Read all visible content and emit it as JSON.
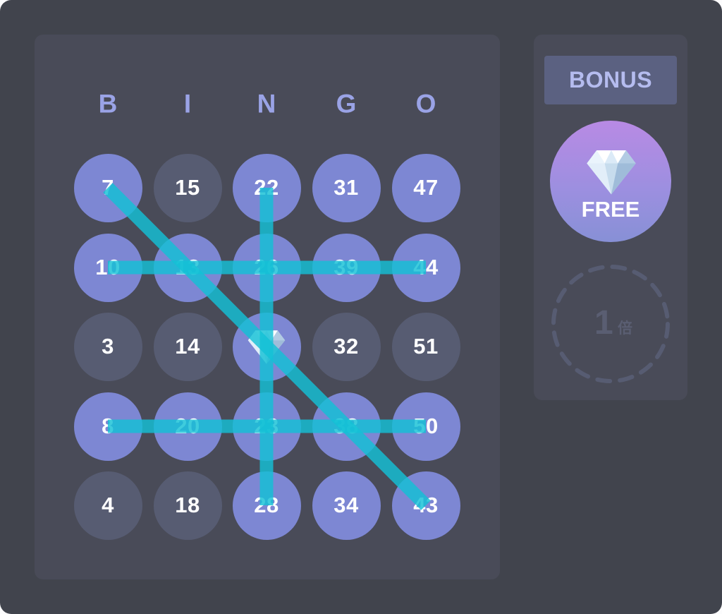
{
  "headers": [
    "B",
    "I",
    "N",
    "G",
    "O"
  ],
  "grid": [
    [
      {
        "label": "7",
        "marked": true
      },
      {
        "label": "15",
        "marked": false
      },
      {
        "label": "22",
        "marked": true
      },
      {
        "label": "31",
        "marked": true
      },
      {
        "label": "47",
        "marked": true
      }
    ],
    [
      {
        "label": "10",
        "marked": true
      },
      {
        "label": "13",
        "marked": true
      },
      {
        "label": "26",
        "marked": true
      },
      {
        "label": "39",
        "marked": true
      },
      {
        "label": "44",
        "marked": true
      }
    ],
    [
      {
        "label": "3",
        "marked": false
      },
      {
        "label": "14",
        "marked": false
      },
      {
        "label": "",
        "marked": true,
        "free": true,
        "icon": "diamond-icon"
      },
      {
        "label": "32",
        "marked": false
      },
      {
        "label": "51",
        "marked": false
      }
    ],
    [
      {
        "label": "8",
        "marked": true
      },
      {
        "label": "20",
        "marked": true
      },
      {
        "label": "23",
        "marked": true
      },
      {
        "label": "38",
        "marked": true
      },
      {
        "label": "50",
        "marked": true
      }
    ],
    [
      {
        "label": "4",
        "marked": false
      },
      {
        "label": "18",
        "marked": false
      },
      {
        "label": "28",
        "marked": true
      },
      {
        "label": "34",
        "marked": true
      },
      {
        "label": "43",
        "marked": true
      }
    ]
  ],
  "bingo_lines": [
    {
      "type": "row",
      "index": 1
    },
    {
      "type": "row",
      "index": 3
    },
    {
      "type": "column",
      "index": 2
    },
    {
      "type": "diagonal",
      "direction": "main"
    }
  ],
  "sidebar": {
    "bonus_label": "BONUS",
    "free_label": "FREE",
    "free_icon": "diamond-icon",
    "multiplier_value": "1",
    "multiplier_unit": "倍"
  },
  "colors": {
    "background": "#41444d",
    "panel": "#494b58",
    "marked_cell": "#7d87d3",
    "unmarked_cell": "#575c72",
    "header_text": "#9aa3e6",
    "line": "#14c1d6",
    "bonus_button": "#5b6181",
    "bonus_text": "#b5bcef",
    "free_gradient_top": "#b88ae4",
    "free_gradient_bottom": "#8790d6",
    "multiplier": "#5a5e72"
  }
}
